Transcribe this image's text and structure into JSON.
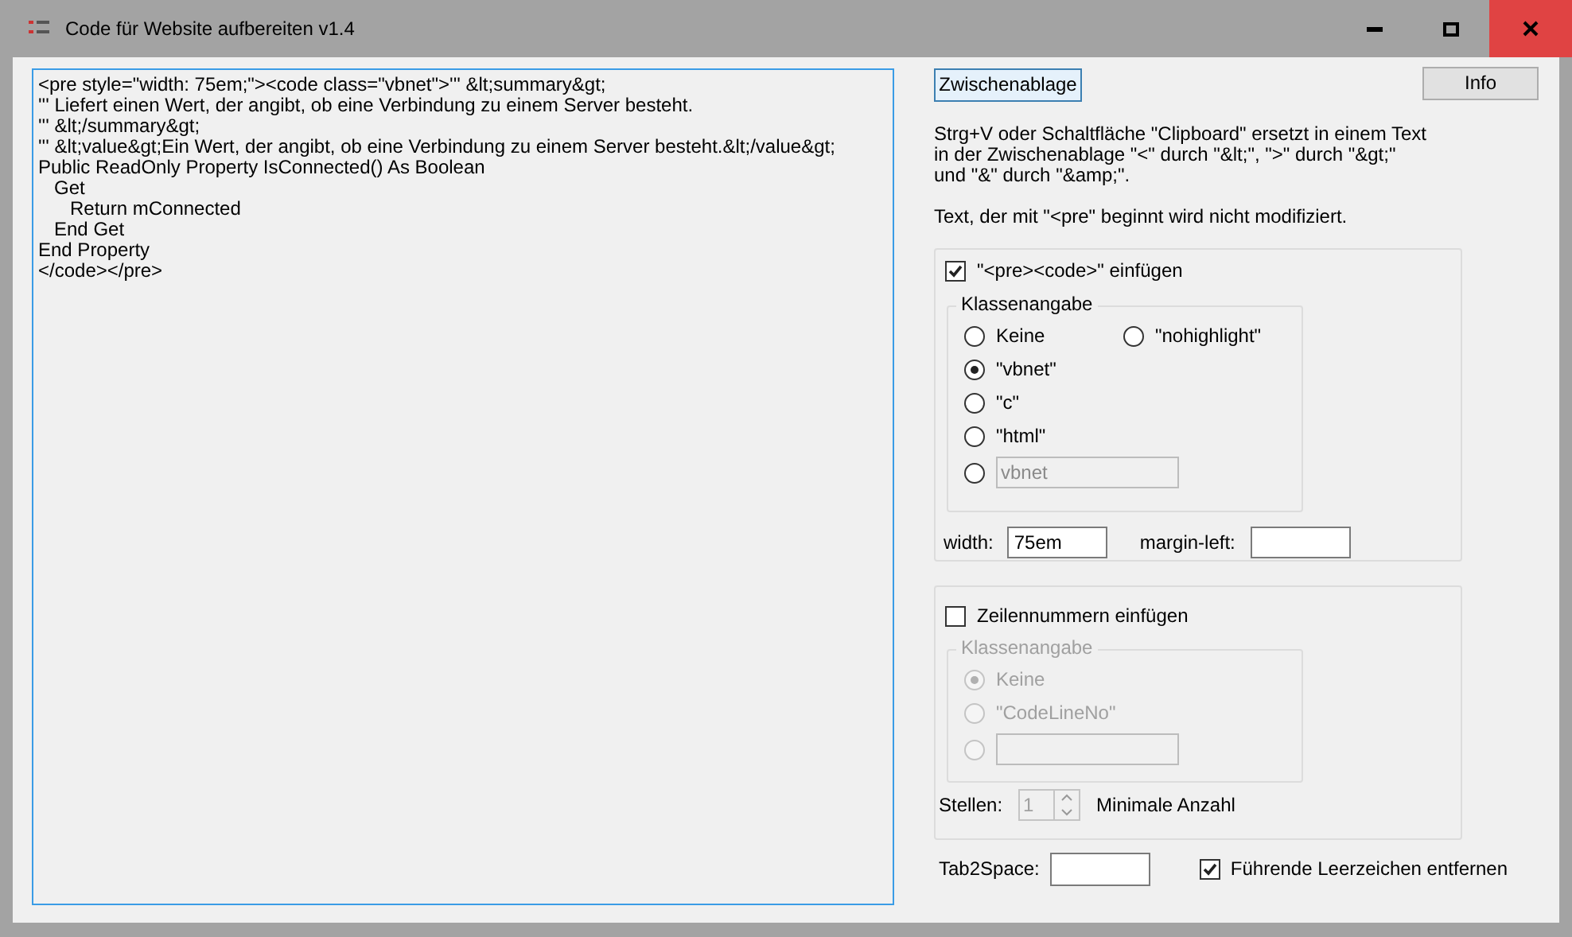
{
  "window": {
    "title": "Code für Website aufbereiten v1.4"
  },
  "editor": {
    "lines": [
      "<pre style=\"width: 75em;\"><code class=\"vbnet\">''' &lt;summary&gt;",
      "''' Liefert einen Wert, der angibt, ob eine Verbindung zu einem Server besteht.",
      "''' &lt;/summary&gt;",
      "''' &lt;value&gt;Ein Wert, der angibt, ob eine Verbindung zu einem Server besteht.&lt;/value&gt;",
      "Public ReadOnly Property IsConnected() As Boolean",
      "   Get",
      "      Return mConnected",
      "   End Get",
      "End Property",
      "</code></pre>"
    ]
  },
  "clipboard_button": "Zwischenablage",
  "info_button": "Info",
  "description": [
    "Strg+V oder Schaltfläche \"Clipboard\" ersetzt in einem Text in der Zwischenablage \"<\" durch \"&lt;\", \">\" durch \"&gt;\" und \"&\" durch \"&amp;\".",
    "Text, der mit \"<pre\" beginnt wird nicht modifiziert."
  ],
  "pre_code": {
    "label": "\"<pre><code>\" einfügen",
    "checked": true,
    "class_group": {
      "title": "Klassenangabe",
      "disabled": false,
      "options": [
        {
          "kind": "radio",
          "label": "Keine",
          "selected": false
        },
        {
          "kind": "radio",
          "label": "\"nohighlight\"",
          "selected": false
        },
        {
          "kind": "radio",
          "label": "\"vbnet\"",
          "selected": true
        },
        {
          "kind": "radio",
          "label": "\"c\"",
          "selected": false
        },
        {
          "kind": "radio",
          "label": "\"html\"",
          "selected": false
        },
        {
          "kind": "custom",
          "value": "vbnet",
          "selected": false
        }
      ]
    },
    "width": {
      "label": "width:",
      "value": "75em"
    },
    "margin_left": {
      "label": "margin-left:"
    }
  },
  "line_numbers": {
    "label": "Zeilennummern einfügen",
    "checked": false,
    "class_group": {
      "title": "Klassenangabe",
      "disabled": true,
      "options": [
        {
          "kind": "radio",
          "label": "Keine",
          "selected": true
        },
        {
          "kind": "radio",
          "label": "\"CodeLineNo\"",
          "selected": false
        },
        {
          "kind": "custom",
          "selected": false
        }
      ]
    },
    "digits": {
      "label": "Stellen:",
      "value": "1",
      "note": "Minimale Anzahl",
      "disabled": true
    }
  },
  "tab2space": {
    "label": "Tab2Space:"
  },
  "trim_leading": {
    "label": "Führende Leerzeichen entfernen",
    "checked": true
  }
}
